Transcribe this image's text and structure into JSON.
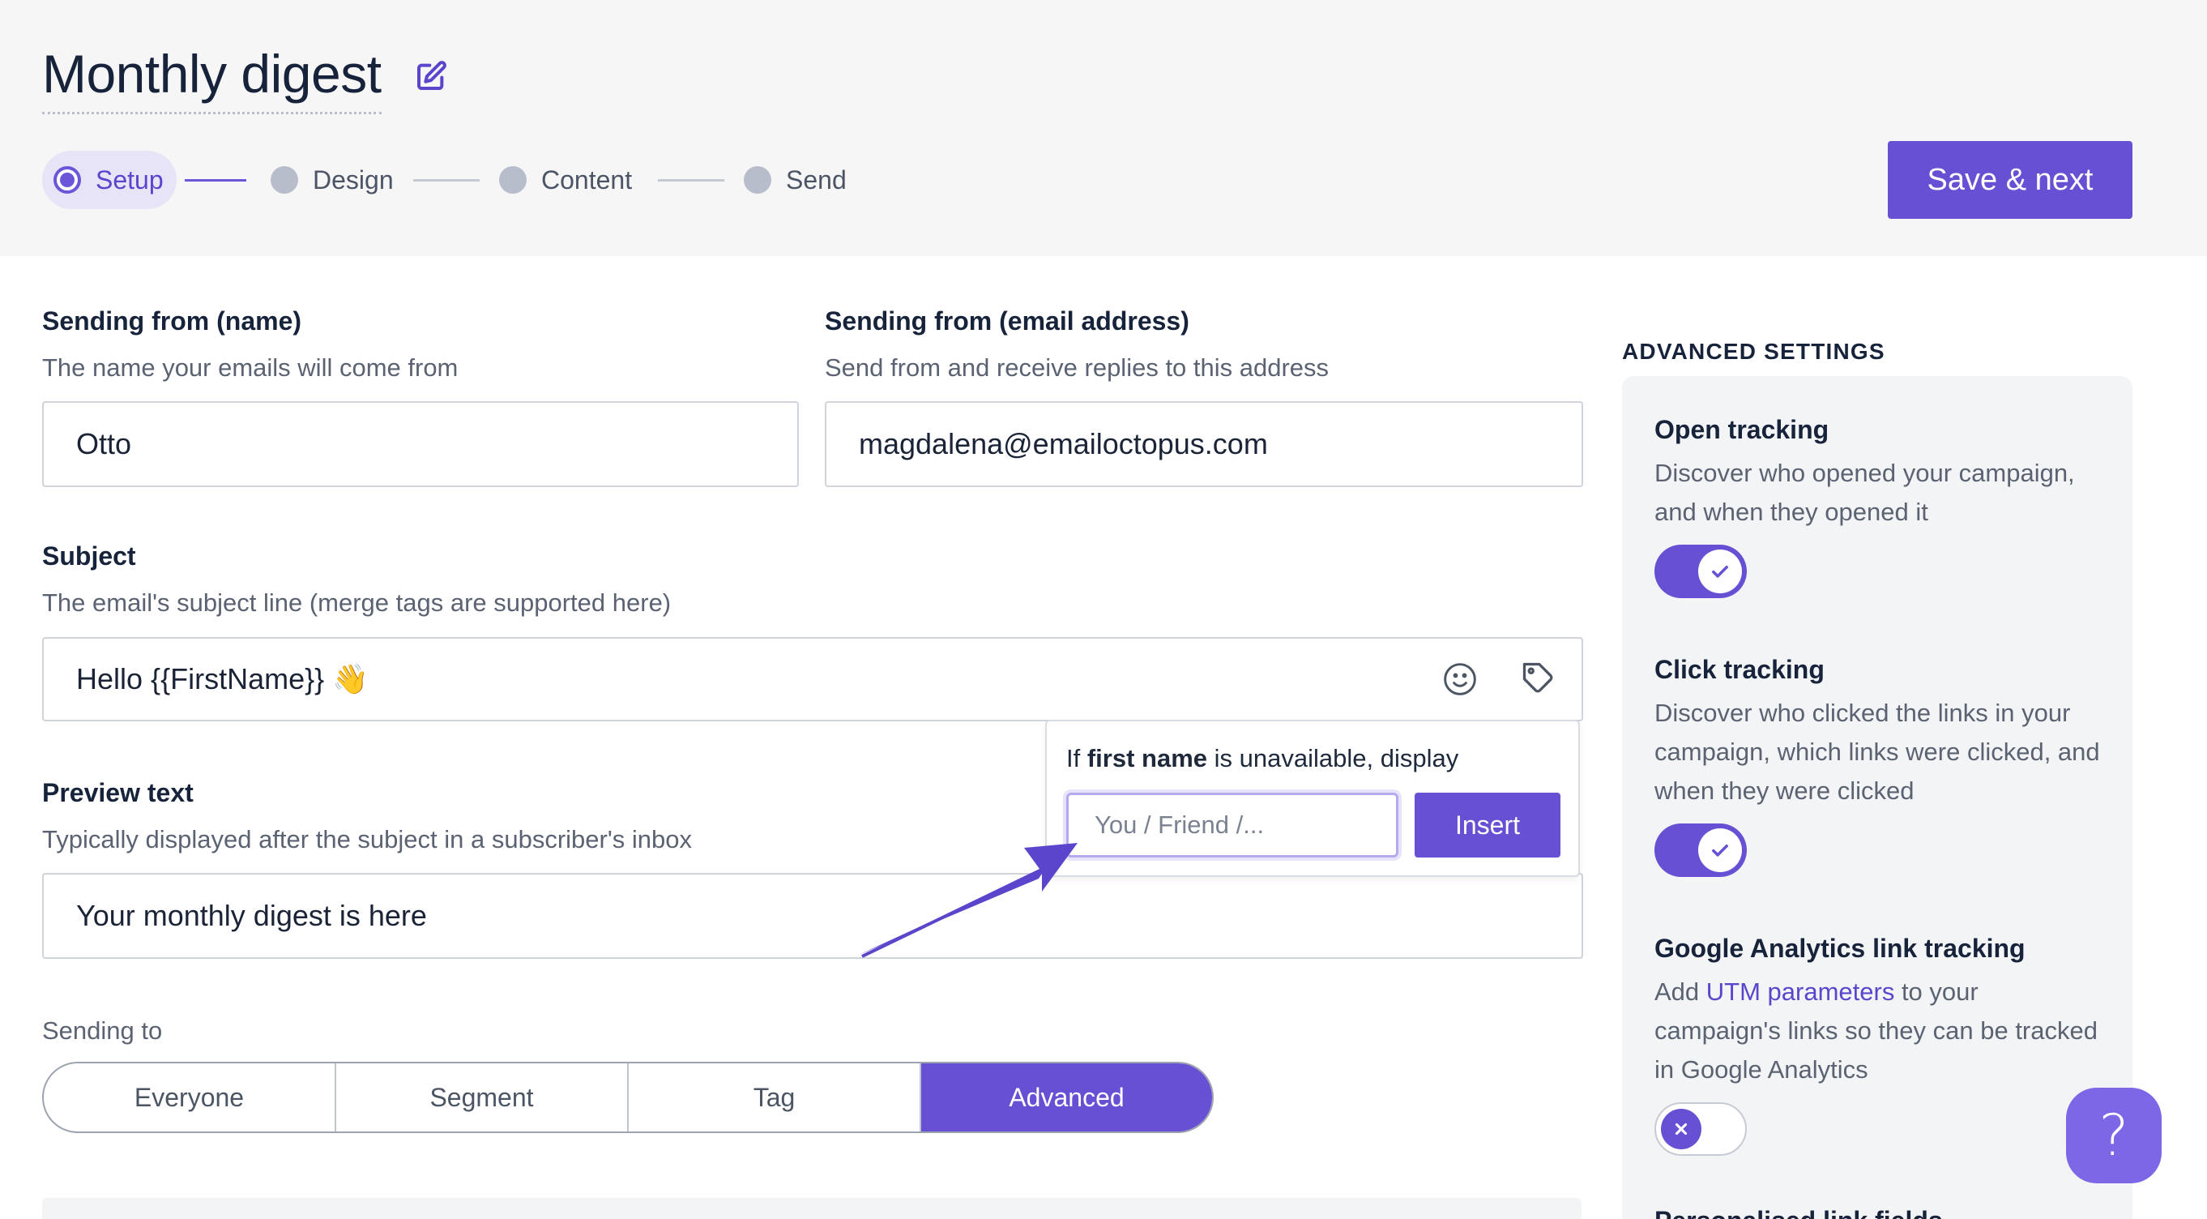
{
  "header": {
    "title": "Monthly digest",
    "edit_icon": "edit-icon",
    "save_button": "Save & next"
  },
  "stepper": {
    "steps": [
      {
        "label": "Setup",
        "state": "active"
      },
      {
        "label": "Design",
        "state": "pending"
      },
      {
        "label": "Content",
        "state": "pending"
      },
      {
        "label": "Send",
        "state": "pending"
      }
    ]
  },
  "form": {
    "from_name": {
      "label": "Sending from (name)",
      "help": "The name your emails will come from",
      "value": "Otto"
    },
    "from_email": {
      "label": "Sending from (email address)",
      "help": "Send from and receive replies to this address",
      "value": "magdalena@emailoctopus.com"
    },
    "subject": {
      "label": "Subject",
      "help": "The email's subject line (merge tags are supported here)",
      "value": "Hello {{FirstName}} 👋",
      "emoji_icon": "smiley-icon",
      "tag_icon": "tag-icon"
    },
    "preview_text": {
      "label": "Preview text",
      "help": "Typically displayed after the subject in a subscriber's inbox",
      "value": "Your monthly digest is here"
    },
    "sending_to": {
      "label": "Sending to",
      "options": [
        "Everyone",
        "Segment",
        "Tag",
        "Advanced"
      ],
      "selected": "Advanced"
    }
  },
  "merge_popup": {
    "text_prefix": "If ",
    "field_name": "first name",
    "text_suffix": " is unavailable, display",
    "placeholder": "You / Friend /...",
    "insert_button": "Insert"
  },
  "advanced": {
    "heading": "ADVANCED SETTINGS",
    "open_tracking": {
      "title": "Open tracking",
      "desc": "Discover who opened your campaign, and when they opened it",
      "enabled": true
    },
    "click_tracking": {
      "title": "Click tracking",
      "desc": "Discover who clicked the links in your campaign, which links were clicked, and when they were clicked",
      "enabled": true
    },
    "ga_tracking": {
      "title": "Google Analytics link tracking",
      "desc_prefix": "Add ",
      "desc_link": "UTM parameters",
      "desc_suffix": " to your campaign's links so they can be tracked in Google Analytics",
      "enabled": false
    },
    "next_partial": "Personalised link fields"
  },
  "help_button": "?",
  "colors": {
    "accent": "#6750d4",
    "accent_light": "#e7e4f7",
    "text_dark": "#16233a",
    "text_muted": "#5b6373"
  }
}
